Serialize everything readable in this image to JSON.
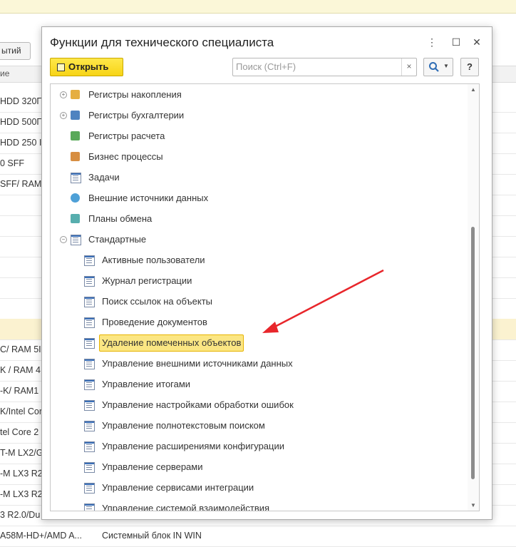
{
  "background": {
    "button_label": "ытий",
    "header_text": "ие",
    "rows": [
      {
        "c1": "HDD 320Г"
      },
      {
        "c1": "HDD 500Г"
      },
      {
        "c1": "HDD 250 I"
      },
      {
        "c1": "0 SFF"
      },
      {
        "c1": "SFF/ RAM"
      },
      {
        "c1": ""
      },
      {
        "c1": ""
      },
      {
        "c1": ""
      },
      {
        "c1": ""
      },
      {
        "c1": ""
      },
      {
        "c1": ""
      },
      {
        "c1": "",
        "selected": true
      },
      {
        "c1": "C/ RAM 5I"
      },
      {
        "c1": "K / RAM 4"
      },
      {
        "c1": "-K/ RAM1"
      },
      {
        "c1": "K/Intel Cor"
      },
      {
        "c1": "tel Core 2"
      },
      {
        "c1": "T-M LX2/G"
      },
      {
        "c1": "-M LX3 R2"
      },
      {
        "c1": "-M LX3 R2"
      },
      {
        "c1": "3 R2.0/Du"
      },
      {
        "c1": "A58M-HD+/AMD A...",
        "c2": "Системный блок IN WIN"
      }
    ]
  },
  "dialog": {
    "title": "Функции для технического специалиста",
    "controls": {
      "menu": "⋮",
      "maximize": "☐",
      "close": "✕"
    },
    "open_button": "Открыть",
    "search": {
      "placeholder": "Поиск (Ctrl+F)",
      "value": "",
      "clear": "×"
    },
    "find_button_icon": "magnifier-icon",
    "help_button": "?",
    "tree": [
      {
        "label": "Регистры накопления",
        "level": 0,
        "expander": "+",
        "icon": "accumulation-register-icon"
      },
      {
        "label": "Регистры бухгалтерии",
        "level": 0,
        "expander": "+",
        "icon": "accounting-register-icon"
      },
      {
        "label": "Регистры расчета",
        "level": 0,
        "expander": "",
        "icon": "calculation-register-icon"
      },
      {
        "label": "Бизнес процессы",
        "level": 0,
        "expander": "",
        "icon": "business-process-icon"
      },
      {
        "label": "Задачи",
        "level": 0,
        "expander": "",
        "icon": "task-icon"
      },
      {
        "label": "Внешние источники данных",
        "level": 0,
        "expander": "",
        "icon": "external-data-source-icon"
      },
      {
        "label": "Планы обмена",
        "level": 0,
        "expander": "",
        "icon": "exchange-plan-icon"
      },
      {
        "label": "Стандартные",
        "level": 0,
        "expander": "−",
        "icon": "standard-folder-icon"
      },
      {
        "label": "Активные пользователи",
        "level": 1,
        "icon": "form-icon"
      },
      {
        "label": "Журнал регистрации",
        "level": 1,
        "icon": "form-icon"
      },
      {
        "label": "Поиск ссылок на объекты",
        "level": 1,
        "icon": "form-icon"
      },
      {
        "label": "Проведение документов",
        "level": 1,
        "icon": "form-icon"
      },
      {
        "label": "Удаление помеченных объектов",
        "level": 1,
        "icon": "form-icon",
        "selected": true
      },
      {
        "label": "Управление внешними источниками данных",
        "level": 1,
        "icon": "form-icon"
      },
      {
        "label": "Управление итогами",
        "level": 1,
        "icon": "form-icon"
      },
      {
        "label": "Управление настройками обработки ошибок",
        "level": 1,
        "icon": "form-icon"
      },
      {
        "label": "Управление полнотекстовым поиском",
        "level": 1,
        "icon": "form-icon"
      },
      {
        "label": "Управление расширениями конфигурации",
        "level": 1,
        "icon": "form-icon"
      },
      {
        "label": "Управление серверами",
        "level": 1,
        "icon": "form-icon"
      },
      {
        "label": "Управление сервисами интеграции",
        "level": 1,
        "icon": "form-icon"
      },
      {
        "label": "Управление системой взаимодействия",
        "level": 1,
        "icon": "form-icon"
      }
    ]
  },
  "colors": {
    "accent_yellow": "#f7d416",
    "selection": "#fbe683",
    "arrow": "#e8262b"
  }
}
